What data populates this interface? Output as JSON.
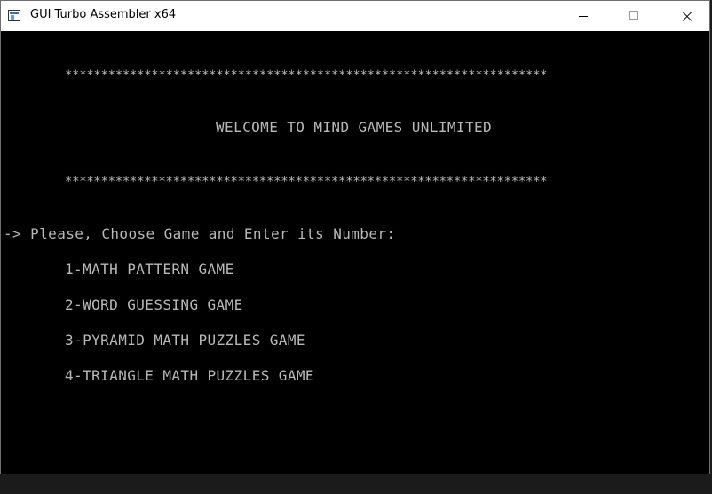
{
  "window": {
    "title": "GUI Turbo Assembler x64",
    "icon": "app-window-icon",
    "controls": [
      "minimize-icon",
      "maximize-icon",
      "close-icon"
    ]
  },
  "console": {
    "stars_top": "*******************************************************************",
    "welcome": "WELCOME TO MIND GAMES UNLIMITED",
    "stars_bottom": "*******************************************************************",
    "prompt": "-> Please, Choose Game and Enter its Number:",
    "options": [
      "1-MATH PATTERN GAME",
      "2-WORD GUESSING GAME",
      "3-PYRAMID MATH PUZZLES GAME",
      "4-TRIANGLE MATH PUZZLES GAME"
    ]
  },
  "colors": {
    "console_bg": "#000000",
    "console_text": "#b8b8b8",
    "titlebar_bg": "#ffffff"
  }
}
